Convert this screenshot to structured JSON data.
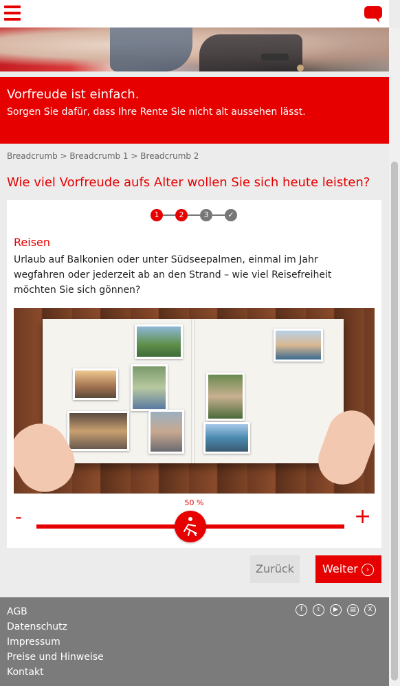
{
  "header": {
    "menu_icon": "hamburger-menu-icon",
    "chat_icon": "chat-bubble-icon"
  },
  "banner": {
    "headline": "Vorfreude ist einfach.",
    "subline": "Sorgen Sie dafür, dass Ihre Rente Sie nicht alt aussehen lässt."
  },
  "breadcrumb": {
    "items": [
      "Breadcrumb",
      "Breadcrumb 1",
      "Breadcrumb 2"
    ],
    "separator": ">"
  },
  "question": "Wie viel Vorfreude aufs Alter wollen Sie sich heute leisten?",
  "steps": {
    "items": [
      {
        "label": "1",
        "state": "done"
      },
      {
        "label": "2",
        "state": "current"
      },
      {
        "label": "3",
        "state": "todo"
      },
      {
        "label": "✓",
        "state": "todo"
      }
    ]
  },
  "topic": {
    "title": "Reisen",
    "description": "Urlaub auf Balkonien oder unter Südseepalmen, einmal im Jahr wegfahren oder jederzeit ab an den Strand – wie viel Reisefreiheit möchten Sie sich gönnen?"
  },
  "slider": {
    "value_label": "50 %",
    "value": 0.5,
    "minus_label": "-",
    "plus_label": "+",
    "knob_icon": "beach-chair-icon"
  },
  "buttons": {
    "back_label": "Zurück",
    "next_label": "Weiter",
    "next_icon": "arrow-right-circle-icon"
  },
  "footer": {
    "links": [
      "AGB",
      "Datenschutz",
      "Impressum",
      "Preise und Hinweise",
      "Kontakt"
    ],
    "social": [
      {
        "icon": "facebook-icon",
        "glyph": "f"
      },
      {
        "icon": "twitter-icon",
        "glyph": "t"
      },
      {
        "icon": "youtube-icon",
        "glyph": "▶"
      },
      {
        "icon": "blog-icon",
        "glyph": "▤"
      },
      {
        "icon": "xing-icon",
        "glyph": "X"
      }
    ]
  },
  "colors": {
    "brand": "#e60000",
    "footer": "#7b7b7b"
  }
}
